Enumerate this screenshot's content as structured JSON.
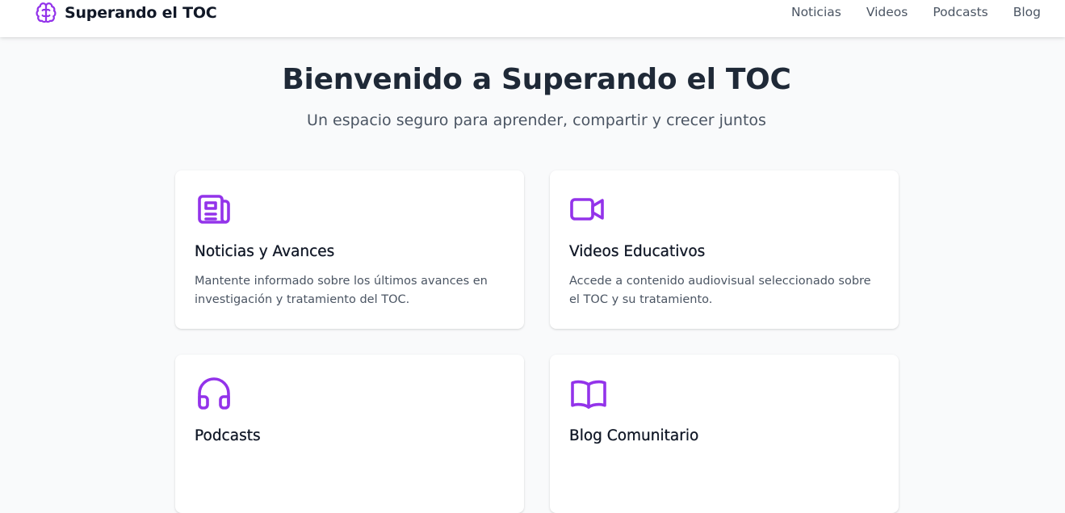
{
  "colors": {
    "accent": "#9333ea",
    "title": "#1f2937",
    "text_muted": "#4b5563",
    "background": "#f9fafb",
    "card_background": "#ffffff"
  },
  "brand": {
    "icon": "brain-icon",
    "name": "Superando el TOC"
  },
  "nav": {
    "items": [
      {
        "label": "Noticias"
      },
      {
        "label": "Videos"
      },
      {
        "label": "Podcasts"
      },
      {
        "label": "Blog"
      }
    ]
  },
  "hero": {
    "title": "Bienvenido a Superando el TOC",
    "subtitle": "Un espacio seguro para aprender, compartir y crecer juntos"
  },
  "cards": [
    {
      "icon": "newspaper-icon",
      "title": "Noticias y Avances",
      "description": "Mantente informado sobre los últimos avances en investigación y tratamiento del TOC."
    },
    {
      "icon": "video-camera-icon",
      "title": "Videos Educativos",
      "description": "Accede a contenido audiovisual seleccionado sobre el TOC y su tratamiento."
    },
    {
      "icon": "headphones-icon",
      "title": "Podcasts",
      "description": ""
    },
    {
      "icon": "book-icon",
      "title": "Blog Comunitario",
      "description": ""
    }
  ]
}
